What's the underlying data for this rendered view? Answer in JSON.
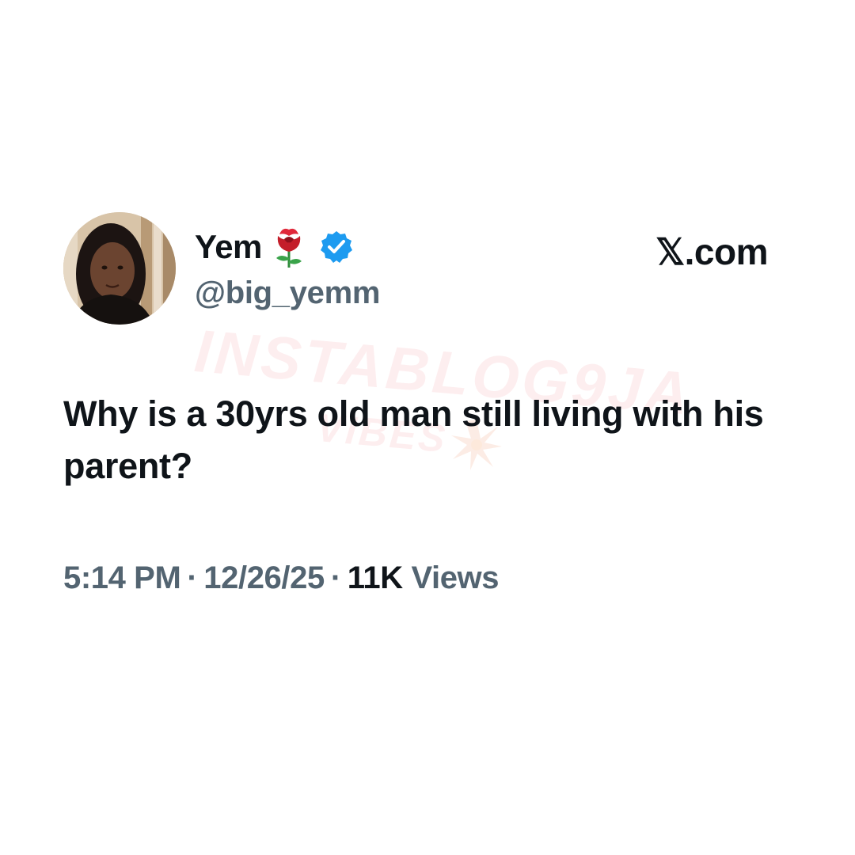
{
  "tweet": {
    "author": {
      "display_name": "Yem",
      "handle": "@big_yemm",
      "name_emoji": "rose-icon",
      "verified_icon": "verified-badge-icon"
    },
    "source": "𝕏.com",
    "text": "Why is a 30yrs old man still living with his parent?",
    "meta": {
      "time": "5:14 PM",
      "separator": "·",
      "date": "12/26/25",
      "views_count": "11K",
      "views_label": "Views"
    }
  },
  "watermark": {
    "main": "INSTABLOG9JA",
    "sub": "VIBES"
  },
  "colors": {
    "text_primary": "#0f1419",
    "text_secondary": "#536471",
    "verified_blue": "#1d9bf0",
    "watermark": "#e95460"
  }
}
